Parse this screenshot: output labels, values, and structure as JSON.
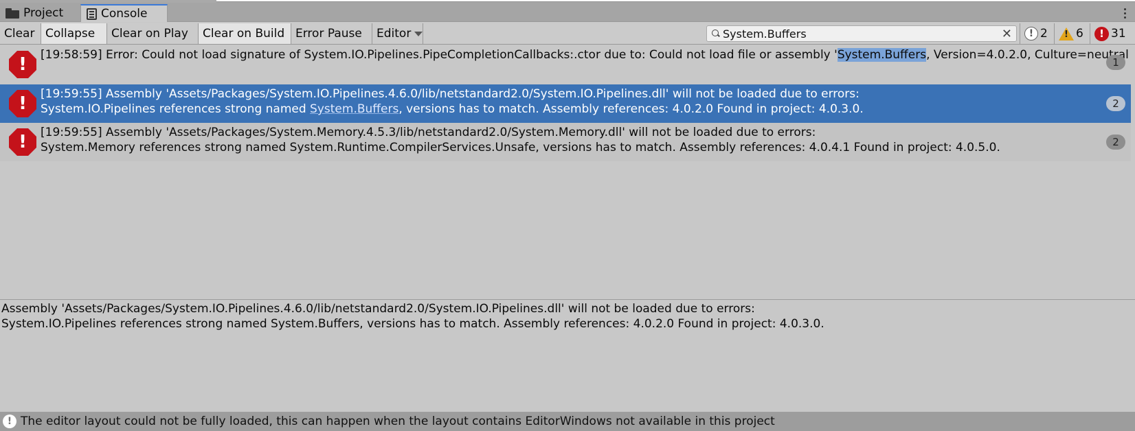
{
  "tabs": [
    {
      "label": "Project",
      "icon": "folder-icon"
    },
    {
      "label": "Console",
      "icon": "console-icon",
      "active": true
    }
  ],
  "toolbar": {
    "clear": "Clear",
    "collapse": "Collapse",
    "clear_on_play": "Clear on Play",
    "clear_on_build": "Clear on Build",
    "error_pause": "Error Pause",
    "editor": "Editor"
  },
  "search": {
    "value": "System.Buffers",
    "clear_glyph": "✕"
  },
  "counters": {
    "info": "2",
    "warnings": "6",
    "errors": "31"
  },
  "logs": [
    {
      "line1_pre": "[19:58:59] Error: Could not load signature of System.IO.Pipelines.PipeCompletionCallbacks:.ctor due to: Could not load file or assembly '",
      "line1_hl": "System.Buffers",
      "line1_post": ", Version=4.0.2.0, Culture=neutral",
      "count": "1"
    },
    {
      "line1": "[19:59:55] Assembly 'Assets/Packages/System.IO.Pipelines.4.6.0/lib/netstandard2.0/System.IO.Pipelines.dll' will not be loaded due to errors:",
      "line2_pre": "System.IO.Pipelines references strong named ",
      "line2_hl": "System.Buffers",
      "line2_post": ", versions has to match. Assembly references: 4.0.2.0 Found in project: 4.0.3.0.",
      "count": "2"
    },
    {
      "line1": "[19:59:55] Assembly 'Assets/Packages/System.Memory.4.5.3/lib/netstandard2.0/System.Memory.dll' will not be loaded due to errors:",
      "line2": "System.Memory references strong named System.Runtime.CompilerServices.Unsafe, versions has to match. Assembly references: 4.0.4.1 Found in project: 4.0.5.0.",
      "count": "2"
    }
  ],
  "detail": {
    "line1": "Assembly 'Assets/Packages/System.IO.Pipelines.4.6.0/lib/netstandard2.0/System.IO.Pipelines.dll' will not be loaded due to errors:",
    "line2": "System.IO.Pipelines references strong named System.Buffers, versions has to match. Assembly references: 4.0.2.0 Found in project: 4.0.3.0."
  },
  "status": {
    "message": "The editor layout could not be fully loaded, this can happen when the layout contains EditorWindows not available in this project"
  },
  "colors": {
    "selected_row": "#3a72b6",
    "error_red": "#c4121a",
    "warning_yellow": "#e2a41a",
    "tab_accent": "#3a79d8"
  }
}
